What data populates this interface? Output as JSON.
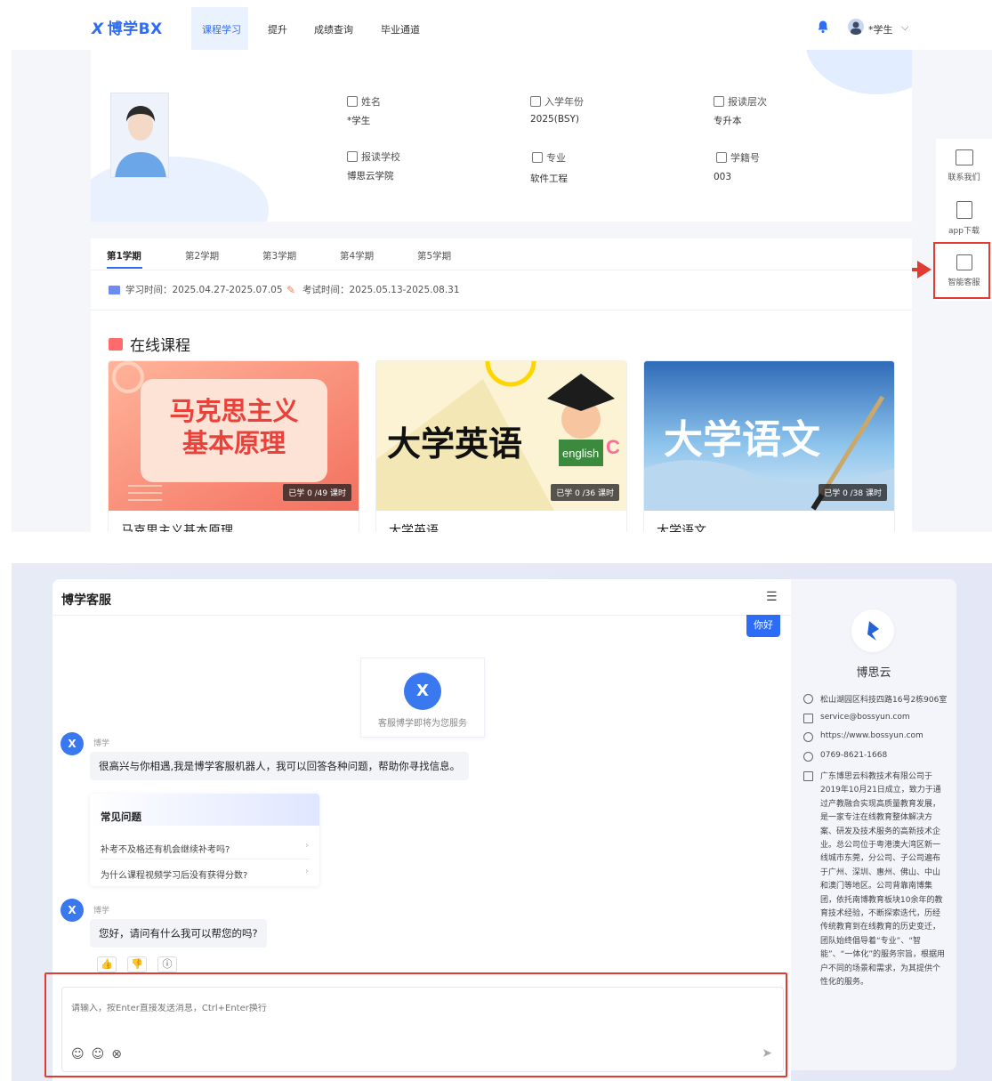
{
  "navbar": {
    "logo_mark": "X",
    "logo_text": "博学BX",
    "items": [
      "课程学习",
      "提升",
      "成绩查询",
      "毕业通道"
    ],
    "user_name": "*学生",
    "user_chevron": "⌵"
  },
  "profile": {
    "fields": [
      {
        "label": "姓名",
        "value": "*学生",
        "icon": "edit-icon"
      },
      {
        "label": "入学年份",
        "value": "2025(BSY)",
        "icon": "calendar-icon"
      },
      {
        "label": "报读层次",
        "value": "专升本",
        "icon": "id-card-icon"
      },
      {
        "label": "报读学校",
        "value": "博思云学院",
        "icon": "school-icon"
      },
      {
        "label": "专业",
        "value": "软件工程",
        "icon": "book-icon"
      },
      {
        "label": "学籍号",
        "value": "003",
        "icon": "number-icon"
      }
    ]
  },
  "dock": {
    "items": [
      {
        "label": "联系我们",
        "icon": "message-icon"
      },
      {
        "label": "app下载",
        "icon": "tablet-icon"
      },
      {
        "label": "智能客服",
        "icon": "customer-service-icon"
      }
    ]
  },
  "terms": {
    "tabs": [
      "第1学期",
      "第2学期",
      "第3学期",
      "第4学期",
      "第5学期"
    ],
    "active": 0,
    "study_time": "学习时间：2025.04.27-2025.07.05",
    "exam_time": "考试时间：2025.05.13-2025.08.31"
  },
  "courses": {
    "section_title": "在线课程",
    "items": [
      {
        "cover_line1": "马克思主义",
        "cover_line2": "基本原理",
        "progress": "已学 0 /49 课时",
        "title": "马克思主义基本原理"
      },
      {
        "cover_line1": "大学英语",
        "cover_line2": "english",
        "progress": "已学 0 /36 课时",
        "title": "大学英语"
      },
      {
        "cover_line1": "大学语文",
        "cover_line2": "",
        "progress": "已学 0 /38 课时",
        "title": "大学语文"
      }
    ]
  },
  "chat": {
    "title": "博学客服",
    "menu_icon": "☰",
    "user_greeting": "你好",
    "welcome_logo": "X",
    "welcome_text": "客服博学即将为您服务",
    "bot_name": "博学",
    "bot_avatar": "X",
    "messages": [
      "很高兴与你相遇,我是博学客服机器人，我可以回答各种问题，帮助你寻找信息。",
      "您好，请问有什么我可以帮您的吗?"
    ],
    "faq_title": "常见问题",
    "faq_items": [
      "补考不及格还有机会继续补考吗?",
      "为什么课程视频学习后没有获得分数?"
    ],
    "faq_chevron": "›",
    "feedback": {
      "like": "👍",
      "dislike": "👎",
      "info": "ⓘ"
    },
    "input_placeholder": "请输入，按Enter直接发送消息，Ctrl+Enter换行",
    "tools": {
      "emoji": "☺",
      "voice": "☺",
      "clear": "⊗"
    },
    "send_icon": "➤"
  },
  "company": {
    "name": "博思云",
    "address": "松山湖园区科技四路16号2栋906室",
    "email": "service@bossyun.com",
    "website": "https://www.bossyun.com",
    "phone": "0769-8621-1668",
    "description": "广东博思云科教技术有限公司于2019年10月21日成立，致力于通过产教融合实现高质量教育发展，是一家专注在线教育整体解决方案、研发及技术服务的高新技术企业。总公司位于粤港澳大湾区新一线城市东莞，分公司、子公司遍布于广州、深圳、惠州、佛山、中山和澳门等地区。公司背靠南博集团，依托南博教育板块10余年的教育技术经验，不断探索迭代，历经传统教育到在线教育的历史变迁，团队始终倡导着“专业”、“智能”、“一体化”的服务宗旨，根据用户不同的场景和需求，为其提供个性化的服务。"
  },
  "colors": {
    "brand": "#2d6cf6",
    "highlight": "#e23c32"
  }
}
